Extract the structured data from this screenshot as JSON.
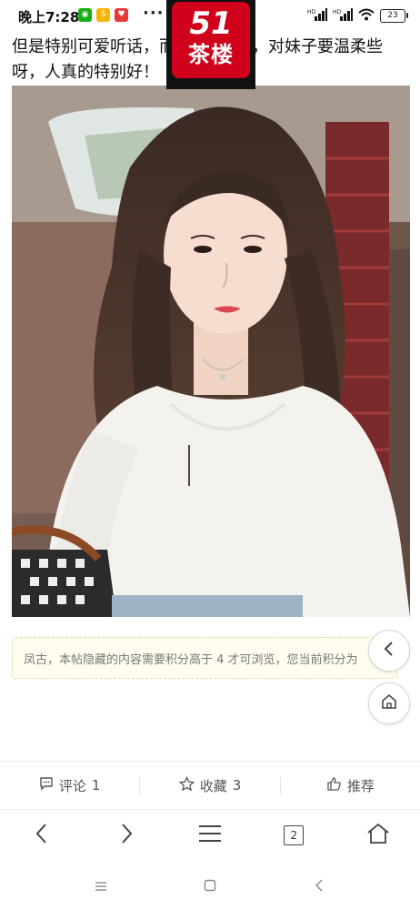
{
  "status_bar": {
    "time": "晚上7:28",
    "battery": "23",
    "signal_label": "HD"
  },
  "logo": {
    "number": "51",
    "name": "茶楼"
  },
  "post": {
    "line1_left": "但是特别可爱听话，而",
    "line1_right": "，对妹子要温柔些",
    "line2": "呀，人真的特别好！"
  },
  "notice": {
    "text": "凤古，本帖隐藏的内容需要积分高于 4 才可浏览，您当前积分为"
  },
  "actions": [
    {
      "label": "评论",
      "count": "1",
      "icon": "comment-icon"
    },
    {
      "label": "收藏",
      "count": "3",
      "icon": "star-icon"
    },
    {
      "label": "推荐",
      "count": "",
      "icon": "thumbs-up-icon"
    }
  ],
  "browser_nav": {
    "tab_count": "2"
  },
  "colors": {
    "logo_red": "#d0021b",
    "notice_bg": "#fffdf0",
    "notice_border": "#e5d9a6"
  }
}
